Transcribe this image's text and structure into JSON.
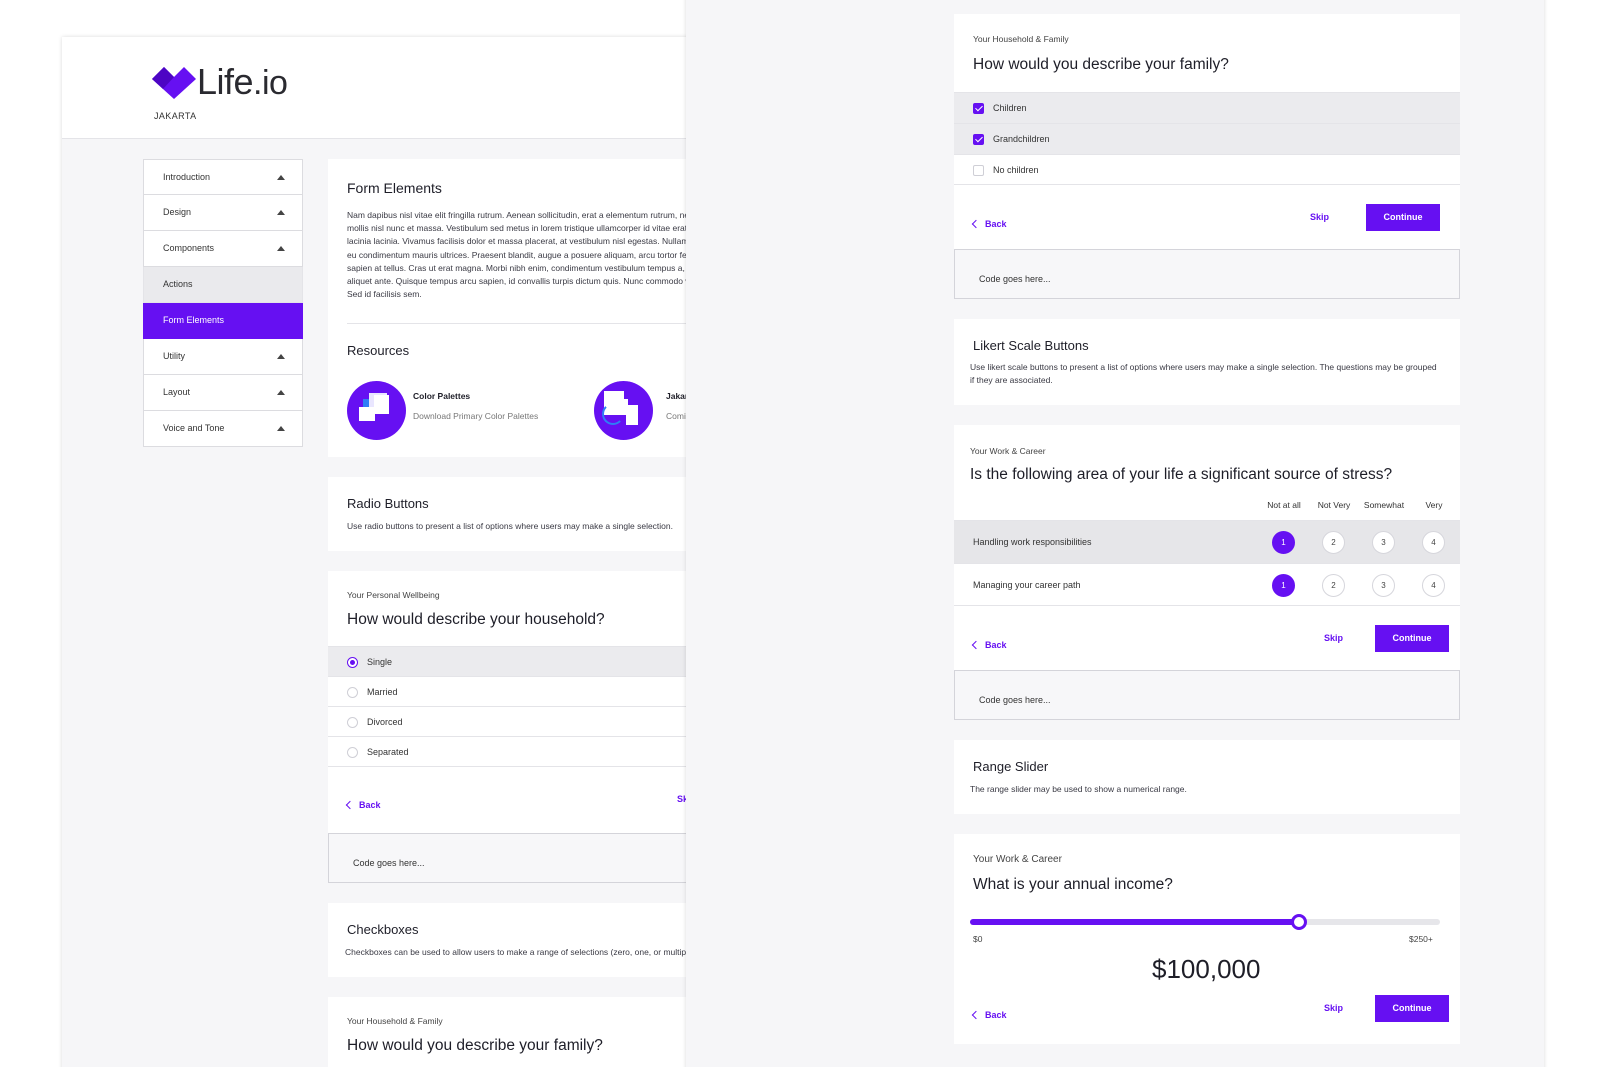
{
  "brand": {
    "logo_word": "Life",
    "logo_suffix": ".io",
    "subtitle": "JAKARTA",
    "color": "#6610f2"
  },
  "sidebar": {
    "items": [
      {
        "label": "Introduction"
      },
      {
        "label": "Design"
      },
      {
        "label": "Components"
      },
      {
        "label": "Actions"
      },
      {
        "label": "Form Elements"
      },
      {
        "label": "Utility"
      },
      {
        "label": "Layout"
      },
      {
        "label": "Voice and Tone"
      }
    ]
  },
  "intro": {
    "title": "Form Elements",
    "body": "Nam dapibus nisl vitae elit fringilla rutrum. Aenean sollicitudin, erat a elementum rutrum, neque sem pretium metus, quis mollis nisl nunc et massa. Vestibulum sed metus in lorem tristique ullamcorper id vitae erat. Nulla mollis sapien sollicitudin lacinia lacinia. Vivamus facilisis dolor et massa placerat, at vestibulum nisl egestas. Nullam rhoncus lacus non odio luctus, eu condimentum mauris ultrices. Praesent blandit, augue a posuere aliquam, arcu tortor feugiat turpis, quis lacinia augue sapien at tellus. Cras ut erat magna. Morbi nibh enim, condimentum vestibulum tempus a, tristique et velit. Sed semper aliquet ante. Quisque tempus arcu sapien, id convallis turpis dictum quis. Nunc commodo vitae risus sit amet sollicitudin. Sed id facilisis sem.",
    "resources_title": "Resources",
    "resources": [
      {
        "title": "Color Palettes",
        "subtitle": "Download Primary Color Palettes"
      },
      {
        "title": "Jakarta Sketch Files",
        "subtitle": "Coming soon"
      }
    ]
  },
  "radio_section": {
    "title": "Radio Buttons",
    "desc": "Use radio buttons to present a list of options where users may make a single selection."
  },
  "household": {
    "category": "Your Personal Wellbeing",
    "question": "How would describe your household?",
    "options": [
      "Single",
      "Married",
      "Divorced",
      "Separated"
    ],
    "selected": "Single"
  },
  "common": {
    "back": "Back",
    "skip": "Skip",
    "continue": "Continue",
    "code": "Code goes here..."
  },
  "checkbox_section": {
    "title": "Checkboxes",
    "desc": "Checkboxes can be used to allow users to make a range of selections (zero, one, or multiple)."
  },
  "family": {
    "category": "Your Household & Family",
    "question": "How would you describe your family?",
    "options": [
      "Children",
      "Grandchildren",
      "No children"
    ],
    "checked": [
      "Children",
      "Grandchildren"
    ]
  },
  "likert_section": {
    "title": "Likert Scale Buttons",
    "desc": "Use likert scale buttons to present a list of options where users may make a single selection. The questions may be grouped if they are associated."
  },
  "stress": {
    "category": "Your Work & Career",
    "question": "Is the following area of your life a significant source of stress?",
    "scale": [
      "Not at all",
      "Not Very",
      "Somewhat",
      "Very"
    ],
    "values": [
      "1",
      "2",
      "3",
      "4"
    ],
    "rows": [
      {
        "label": "Handling work responsibilities",
        "selected": 1
      },
      {
        "label": "Managing your career path",
        "selected": 1
      }
    ]
  },
  "range_section": {
    "title": "Range Slider",
    "desc": "The range slider may be used to show a numerical range."
  },
  "income": {
    "category": "Your Work & Career",
    "question": "What is your annual income?",
    "min_label": "$0",
    "max_label": "$250+",
    "value_label": "$100,000",
    "fill_fraction": 0.7
  }
}
